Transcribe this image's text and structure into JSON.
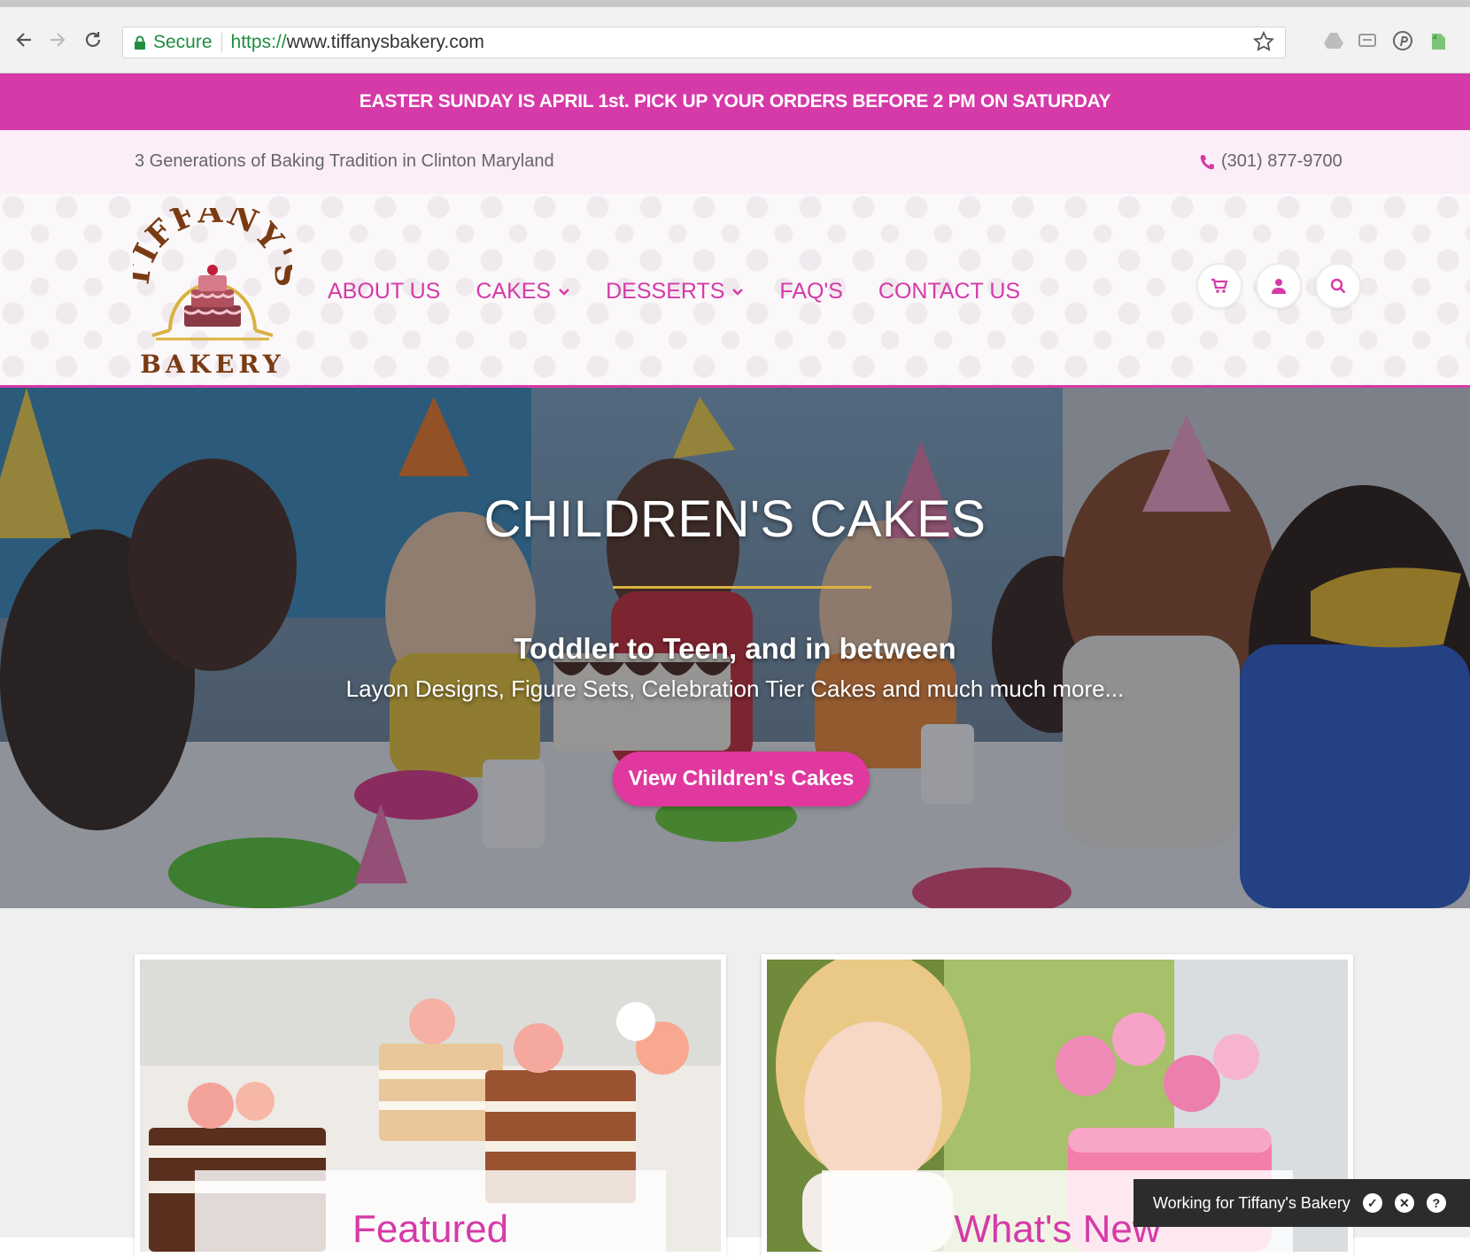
{
  "browser": {
    "secure_label": "Secure",
    "url_protocol": "https://",
    "url_host": "www.tiffanysbakery.com"
  },
  "announcement": "EASTER SUNDAY IS APRIL 1st. PICK UP YOUR ORDERS BEFORE 2 PM ON SATURDAY",
  "infobar": {
    "tagline": "3 Generations of Baking Tradition in Clinton Maryland",
    "phone": "(301) 877-9700"
  },
  "logo": {
    "top_text": "TIFFANY'S",
    "bottom_text": "BAKERY"
  },
  "nav": {
    "items": [
      {
        "label": "ABOUT US"
      },
      {
        "label": "CAKES"
      },
      {
        "label": "DESSERTS"
      },
      {
        "label": "FAQ'S"
      },
      {
        "label": "CONTACT US"
      }
    ]
  },
  "hero": {
    "title": "CHILDREN'S CAKES",
    "subtitle": "Toddler to Teen, and in between",
    "description": "Layon Designs, Figure Sets, Celebration Tier Cakes and much much more...",
    "button_label": "View Children's Cakes"
  },
  "cards": [
    {
      "label": "Featured"
    },
    {
      "label": "What's New"
    }
  ],
  "toast": {
    "text": "Working for Tiffany's Bakery"
  },
  "colors": {
    "brand_pink": "#d63aa8",
    "accent_gold": "#d9b240",
    "logo_brown": "#7a3b12"
  }
}
